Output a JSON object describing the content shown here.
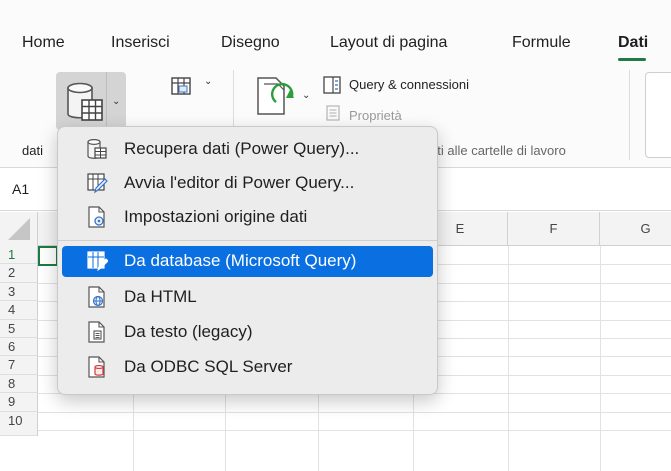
{
  "ribbon": {
    "tabs": [
      {
        "label": "Home"
      },
      {
        "label": "Inserisci"
      },
      {
        "label": "Disegno"
      },
      {
        "label": "Layout di pagina"
      },
      {
        "label": "Formule"
      },
      {
        "label": "Dati"
      }
    ],
    "active_tab": "Dati",
    "query_connections_label": "Query & connessioni",
    "properties_label": "Proprietà",
    "group_label_partial": "nti alle cartelle di lavoro",
    "get_data_group_label": "dati"
  },
  "formula_bar": {
    "name_box": "A1"
  },
  "grid": {
    "visible_columns": [
      "E",
      "F",
      "G"
    ],
    "rows": [
      "1",
      "2",
      "3",
      "4",
      "5",
      "6",
      "7",
      "8",
      "9",
      "10"
    ]
  },
  "menu": {
    "items": [
      {
        "label": "Recupera dati (Power Query)...",
        "icon": "database-table-icon"
      },
      {
        "label": "Avvia l'editor di Power Query...",
        "icon": "table-pencil-icon"
      },
      {
        "label": "Impostazioni origine dati",
        "icon": "document-gear-icon"
      },
      {
        "label": "Da database (Microsoft Query)",
        "icon": "table-query-icon",
        "highlighted": true
      },
      {
        "label": "Da HTML",
        "icon": "document-globe-icon"
      },
      {
        "label": "Da testo (legacy)",
        "icon": "document-text-icon"
      },
      {
        "label": "Da ODBC SQL Server",
        "icon": "document-database-icon"
      }
    ]
  },
  "colors": {
    "accent_green": "#1f7a45",
    "highlight_blue": "#0a6fe0",
    "refresh_green": "#2a9d3c"
  }
}
